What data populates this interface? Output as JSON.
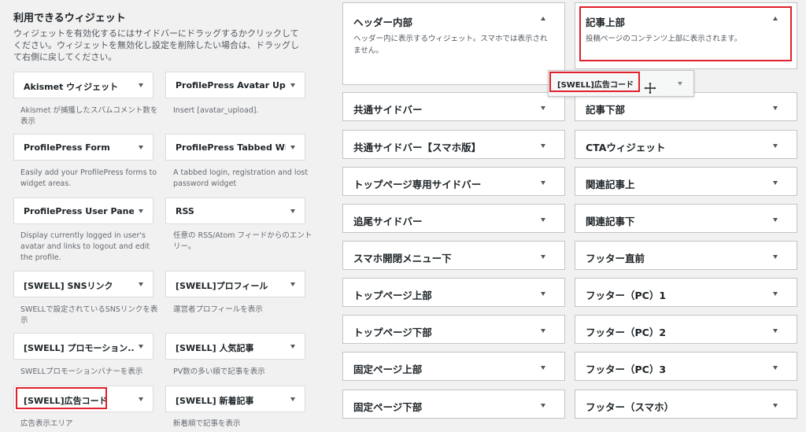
{
  "available": {
    "title": "利用できるウィジェット",
    "description": "ウィジェットを有効化するにはサイドバーにドラッグするかクリックしてください。ウィジェットを無効化し設定を削除したい場合は、ドラッグして右側に戻してください。",
    "widgets": [
      {
        "title": "Akismet ウィジェット",
        "desc": "Akismet が捕獲したスパムコメント数を表示"
      },
      {
        "title": "ProfilePress Avatar Upl...",
        "desc": "Insert [avatar_upload]."
      },
      {
        "title": "ProfilePress Form",
        "desc": "Easily add your ProfilePress forms to widget areas."
      },
      {
        "title": "ProfilePress Tabbed Wi...",
        "desc": "A tabbed login, registration and lost password widget"
      },
      {
        "title": "ProfilePress User Panel",
        "desc": "Display currently logged in user's avatar and links to logout and edit the profile."
      },
      {
        "title": "RSS",
        "desc": "任意の RSS/Atom フィードからのエントリー。"
      },
      {
        "title": "[SWELL] SNSリンク",
        "desc": "SWELLで設定されているSNSリンクを表示"
      },
      {
        "title": "[SWELL]プロフィール",
        "desc": "運営者プロフィールを表示"
      },
      {
        "title": "[SWELL] プロモーション...",
        "desc": "SWELLプロモーションバナーを表示"
      },
      {
        "title": "[SWELL] 人気記事",
        "desc": "PV数の多い順で記事を表示"
      },
      {
        "title": "[SWELL]広告コード",
        "desc": "広告表示エリア"
      },
      {
        "title": "[SWELL] 新着記事",
        "desc": "新着順で記事を表示"
      }
    ]
  },
  "areas_col1": [
    {
      "title": "ヘッダー内部",
      "desc": "ヘッダー内に表示するウィジェット。スマホでは表示されません。"
    },
    {
      "title": "共通サイドバー"
    },
    {
      "title": "共通サイドバー【スマホ版】"
    },
    {
      "title": "トップページ専用サイドバー"
    },
    {
      "title": "追尾サイドバー"
    },
    {
      "title": "スマホ開閉メニュー下"
    },
    {
      "title": "トップページ上部"
    },
    {
      "title": "トップページ下部"
    },
    {
      "title": "固定ページ上部"
    },
    {
      "title": "固定ページ下部"
    }
  ],
  "areas_col2": [
    {
      "title": "記事上部",
      "desc": "投稿ページのコンテンツ上部に表示されます。"
    },
    {
      "title": "記事下部"
    },
    {
      "title": "CTAウィジェット"
    },
    {
      "title": "関連記事上"
    },
    {
      "title": "関連記事下"
    },
    {
      "title": "フッター直前"
    },
    {
      "title": "フッター（PC）1"
    },
    {
      "title": "フッター（PC）2"
    },
    {
      "title": "フッター（PC）3"
    },
    {
      "title": "フッター（スマホ）"
    }
  ],
  "dragging_widget": {
    "title": "[SWELL]広告コード"
  },
  "colors": {
    "highlight": "#e0202a",
    "border": "#c3c4c7",
    "background": "#f1f1f1"
  },
  "icons": {
    "drag_cursor": "move-icon",
    "toggle": "caret-down-icon"
  }
}
